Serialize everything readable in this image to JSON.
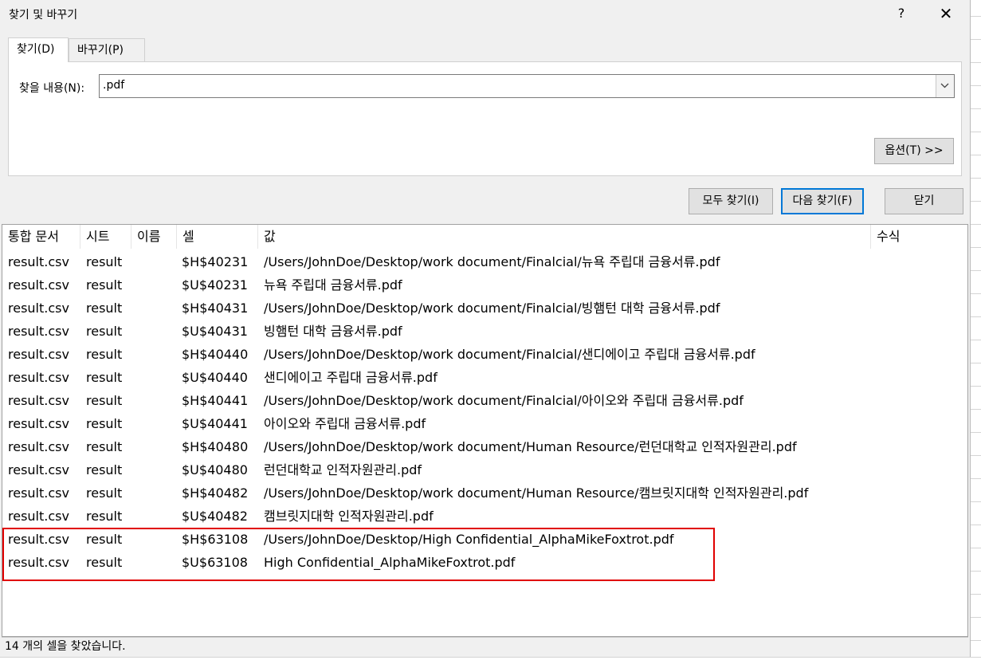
{
  "dialog": {
    "title": "찾기 및 바꾸기",
    "help_label": "?",
    "close_label": "✕"
  },
  "tabs": [
    {
      "label": "찾기(D)",
      "active": true
    },
    {
      "label": "바꾸기(P)",
      "active": false
    }
  ],
  "find": {
    "label": "찾을 내용(N):",
    "value": ".pdf"
  },
  "buttons": {
    "options": "옵션(T) >>",
    "find_all": "모두 찾기(I)",
    "find_next": "다음 찾기(F)",
    "close": "닫기"
  },
  "results": {
    "columns": [
      "통합 문서",
      "시트",
      "이름",
      "셀",
      "값",
      "수식"
    ],
    "rows": [
      {
        "book": "result.csv",
        "sheet": "result",
        "cell": "$H$40231",
        "value": "/Users/JohnDoe/Desktop/work document/Finalcial/뉴욕 주립대 금융서류.pdf"
      },
      {
        "book": "result.csv",
        "sheet": "result",
        "cell": "$U$40231",
        "value": "뉴욕 주립대 금융서류.pdf"
      },
      {
        "book": "result.csv",
        "sheet": "result",
        "cell": "$H$40431",
        "value": "/Users/JohnDoe/Desktop/work document/Finalcial/빙햄턴 대학 금융서류.pdf"
      },
      {
        "book": "result.csv",
        "sheet": "result",
        "cell": "$U$40431",
        "value": "빙햄턴 대학 금융서류.pdf"
      },
      {
        "book": "result.csv",
        "sheet": "result",
        "cell": "$H$40440",
        "value": "/Users/JohnDoe/Desktop/work document/Finalcial/샌디에이고 주립대 금융서류.pdf"
      },
      {
        "book": "result.csv",
        "sheet": "result",
        "cell": "$U$40440",
        "value": "샌디에이고 주립대 금융서류.pdf"
      },
      {
        "book": "result.csv",
        "sheet": "result",
        "cell": "$H$40441",
        "value": "/Users/JohnDoe/Desktop/work document/Finalcial/아이오와 주립대 금융서류.pdf"
      },
      {
        "book": "result.csv",
        "sheet": "result",
        "cell": "$U$40441",
        "value": "아이오와 주립대 금융서류.pdf"
      },
      {
        "book": "result.csv",
        "sheet": "result",
        "cell": "$H$40480",
        "value": "/Users/JohnDoe/Desktop/work document/Human Resource/런던대학교 인적자원관리.pdf"
      },
      {
        "book": "result.csv",
        "sheet": "result",
        "cell": "$U$40480",
        "value": "런던대학교 인적자원관리.pdf"
      },
      {
        "book": "result.csv",
        "sheet": "result",
        "cell": "$H$40482",
        "value": "/Users/JohnDoe/Desktop/work document/Human Resource/캠브릿지대학 인적자원관리.pdf"
      },
      {
        "book": "result.csv",
        "sheet": "result",
        "cell": "$U$40482",
        "value": "캠브릿지대학 인적자원관리.pdf"
      },
      {
        "book": "result.csv",
        "sheet": "result",
        "cell": "$H$63108",
        "value": "/Users/JohnDoe/Desktop/High Confidential_AlphaMikeFoxtrot.pdf"
      },
      {
        "book": "result.csv",
        "sheet": "result",
        "cell": "$U$63108",
        "value": "High Confidential_AlphaMikeFoxtrot.pdf"
      }
    ]
  },
  "status": "14 개의 셀을 찾았습니다.",
  "colors": {
    "highlight_border": "#e00000",
    "default_button_border": "#0078d7",
    "dialog_bg": "#f0f0f0"
  }
}
